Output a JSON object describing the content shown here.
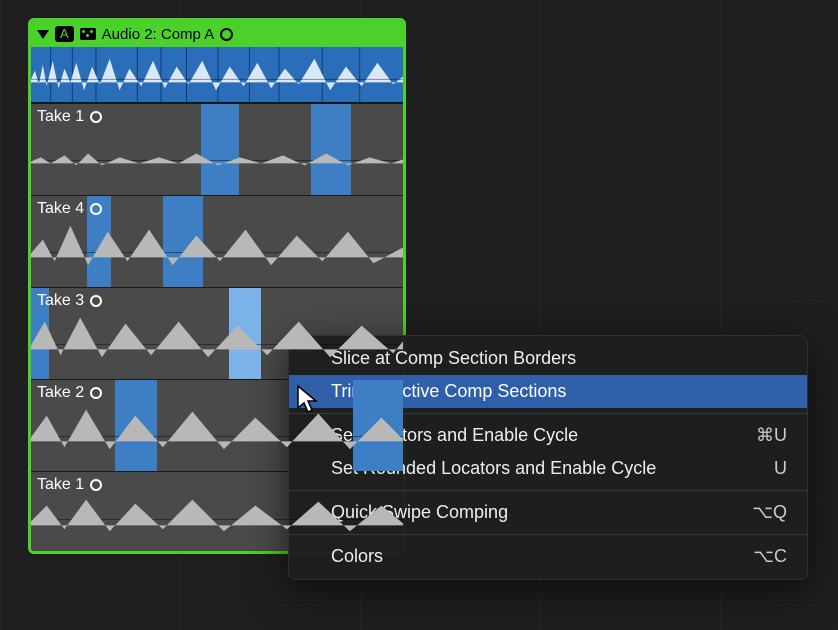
{
  "folder": {
    "badge": "A",
    "title": "Audio 2: Comp A"
  },
  "takes": [
    {
      "label": "Take 1"
    },
    {
      "label": "Take 4"
    },
    {
      "label": "Take 3"
    },
    {
      "label": "Take 2"
    },
    {
      "label": "Take 1"
    }
  ],
  "menu": {
    "slice": "Slice at Comp Section Borders",
    "trim": "Trim to Active Comp Sections",
    "setloc": "Set Locators and Enable Cycle",
    "setloc_sc": "⌘U",
    "setrnd": "Set Rounded Locators and Enable Cycle",
    "setrnd_sc": "U",
    "qsc": "Quick Swipe Comping",
    "qsc_sc": "⌥Q",
    "colors": "Colors",
    "colors_sc": "⌥C"
  }
}
